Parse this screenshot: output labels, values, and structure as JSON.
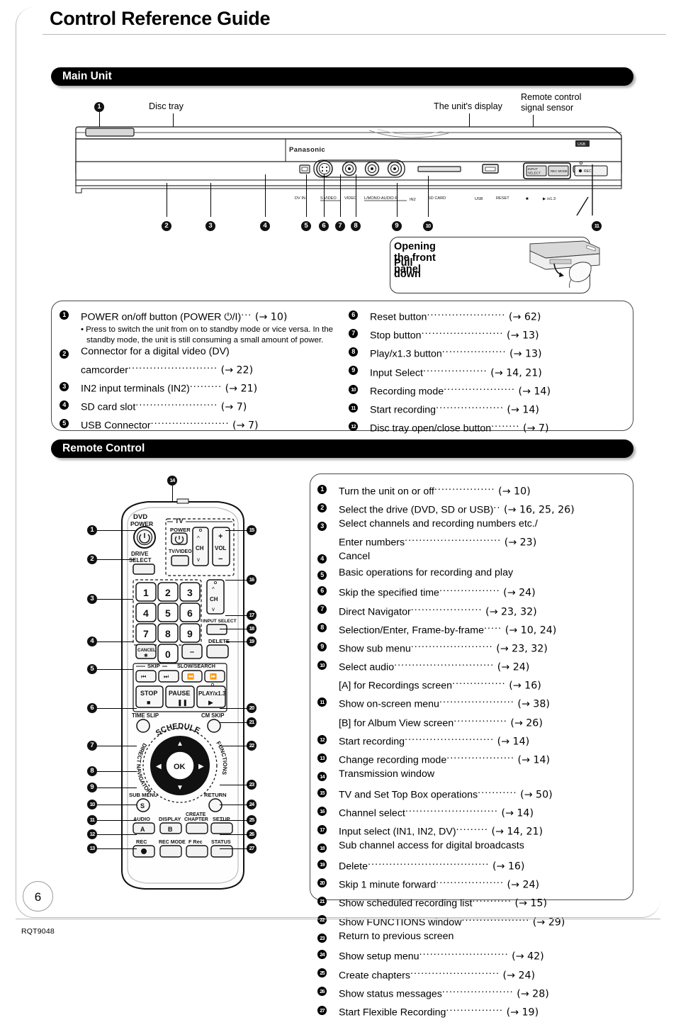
{
  "page": {
    "title": "Control Reference Guide",
    "page_number": "6",
    "footer_code": "RQT9048"
  },
  "sections": {
    "main_unit": "Main Unit",
    "remote_control": "Remote Control"
  },
  "main_unit_diagram": {
    "labels": {
      "disc_tray": "Disc tray",
      "display": "The unit's display",
      "sensor_line1": "Remote control",
      "sensor_line2": "signal sensor"
    },
    "panel_text": {
      "brand": "Panasonic",
      "usb_badge": "USB",
      "dv_in": "DV IN",
      "s_video": "S VIDEO",
      "video": "VIDEO",
      "audio": "L/MONO-AUDIO-R",
      "in2": "IN2",
      "sd_card": "SD CARD",
      "usb_sym": "USB",
      "reset": "RESET",
      "stop_sym": "■",
      "play_sym": "▶ /x1.3",
      "input_select_l1": "INPUT",
      "input_select_l2": "SELECT",
      "rec_mode": "REC MODE",
      "rec": "REC"
    },
    "front_panel_box": {
      "line1": "Opening the front panel",
      "line2": "Pull down"
    }
  },
  "main_unit_legend": {
    "left": [
      {
        "n": "1",
        "text": "POWER on/off button (POWER ⏻/I)",
        "ref": "(→ 10)",
        "note": "Press to switch the unit from on to standby mode or vice versa. In the standby mode, the unit is still consuming a small amount of power."
      },
      {
        "n": "2",
        "text": "Connector for a digital video (DV)",
        "text2": "camcorder",
        "ref": "(→ 22)"
      },
      {
        "n": "3",
        "text": "IN2 input terminals (IN2)",
        "ref": "(→ 21)"
      },
      {
        "n": "4",
        "text": "SD card slot",
        "ref": "(→ 7)"
      },
      {
        "n": "5",
        "text": "USB Connector",
        "ref": "(→ 7)"
      }
    ],
    "right": [
      {
        "n": "6",
        "text": "Reset button",
        "ref": "(→ 62)"
      },
      {
        "n": "7",
        "text": "Stop button",
        "ref": "(→ 13)"
      },
      {
        "n": "8",
        "text": "Play/x1.3 button",
        "ref": "(→ 13)"
      },
      {
        "n": "9",
        "text": "Input Select",
        "ref": "(→ 14, 21)"
      },
      {
        "n": "10",
        "text": "Recording mode",
        "ref": "(→ 14)"
      },
      {
        "n": "11",
        "text": "Start recording",
        "ref": "(→ 14)"
      },
      {
        "n": "12",
        "text": "Disc tray open/close button",
        "ref": "(→ 7)"
      }
    ]
  },
  "remote_diagram": {
    "buttons": {
      "dvd_power_l1": "DVD",
      "dvd_power_l2": "POWER",
      "drive_select_l1": "DRIVE",
      "drive_select_l2": "SELECT",
      "tv": "TV",
      "tv_power": "POWER",
      "tv_video": "TV/VIDEO",
      "ch": "CH",
      "vol": "VOL",
      "plus": "+",
      "minus": "−",
      "keys": [
        "1",
        "2",
        "3",
        "4",
        "5",
        "6",
        "7",
        "8",
        "9",
        "0"
      ],
      "cancel": "CANCEL",
      "input_select": "INPUT SELECT",
      "delete": "DELETE",
      "dash": "–",
      "skip": "SKIP",
      "slow_search": "SLOW/SEARCH",
      "stop": "STOP",
      "pause": "PAUSE",
      "play": "PLAY/x1.3",
      "time_slip": "TIME SLIP",
      "cm_skip": "CM SKIP",
      "schedule": "SCHEDULE",
      "direct_navigator": "DIRECT NAVIGATOR",
      "functions": "FUNCTIONS",
      "ok": "OK",
      "sub_menu": "SUB MENU",
      "return": "RETURN",
      "audio": "AUDIO",
      "display": "DISPLAY",
      "create_chapter_l1": "CREATE",
      "create_chapter_l2": "CHAPTER",
      "setup": "SETUP",
      "rec": "REC",
      "rec_mode": "REC MODE",
      "f_rec": "F Rec",
      "status": "STATUS",
      "btn_a": "A",
      "btn_b": "B",
      "btn_s": "S"
    }
  },
  "remote_legend": [
    {
      "n": "1",
      "text": "Turn the unit on or off",
      "ref": "(→ 10)"
    },
    {
      "n": "2",
      "text": "Select the drive (DVD, SD or USB)",
      "ref": "(→ 16, 25, 26)"
    },
    {
      "n": "3",
      "text": "Select channels and recording numbers etc./",
      "text2": "Enter numbers",
      "ref": "(→ 23)"
    },
    {
      "n": "4",
      "text": "Cancel",
      "ref": ""
    },
    {
      "n": "5",
      "text": "Basic operations for recording and play",
      "ref": ""
    },
    {
      "n": "6",
      "text": "Skip the specified time",
      "ref": "(→ 24)"
    },
    {
      "n": "7",
      "text": "Direct Navigator",
      "ref": "(→ 23, 32)"
    },
    {
      "n": "8",
      "text": "Selection/Enter, Frame-by-frame",
      "ref": "(→ 10, 24)"
    },
    {
      "n": "9",
      "text": "Show sub menu",
      "ref": "(→ 23, 32)"
    },
    {
      "n": "10",
      "text": "Select audio",
      "ref": "(→ 24)",
      "sub": "[A] for Recordings screen",
      "sub_ref": "(→ 16)"
    },
    {
      "n": "11",
      "text": "Show on-screen menu",
      "ref": "(→ 38)",
      "sub": "[B] for Album View screen",
      "sub_ref": "(→ 26)"
    },
    {
      "n": "12",
      "text": "Start recording",
      "ref": "(→ 14)"
    },
    {
      "n": "13",
      "text": "Change recording mode",
      "ref": "(→ 14)"
    },
    {
      "n": "14",
      "text": "Transmission window",
      "ref": ""
    },
    {
      "n": "15",
      "text": "TV and Set Top Box operations",
      "ref": "(→ 50)"
    },
    {
      "n": "16",
      "text": "Channel select",
      "ref": "(→ 14)"
    },
    {
      "n": "17",
      "text": "Input select (IN1, IN2, DV)",
      "ref": "(→ 14, 21)"
    },
    {
      "n": "18",
      "text": "Sub channel access for digital broadcasts",
      "ref": ""
    },
    {
      "n": "19",
      "text": "Delete",
      "ref": "(→ 16)"
    },
    {
      "n": "20",
      "text": "Skip 1 minute forward",
      "ref": "(→ 24)"
    },
    {
      "n": "21",
      "text": "Show scheduled recording list",
      "ref": "(→ 15)"
    },
    {
      "n": "22",
      "text": "Show FUNCTIONS window",
      "ref": "(→ 29)"
    },
    {
      "n": "23",
      "text": "Return to previous screen",
      "ref": ""
    },
    {
      "n": "24",
      "text": "Show setup menu",
      "ref": "(→ 42)"
    },
    {
      "n": "25",
      "text": "Create chapters",
      "ref": "(→ 24)"
    },
    {
      "n": "26",
      "text": "Show status messages",
      "ref": "(→ 28)"
    },
    {
      "n": "27",
      "text": "Start Flexible Recording",
      "ref": "(→ 19)"
    }
  ]
}
